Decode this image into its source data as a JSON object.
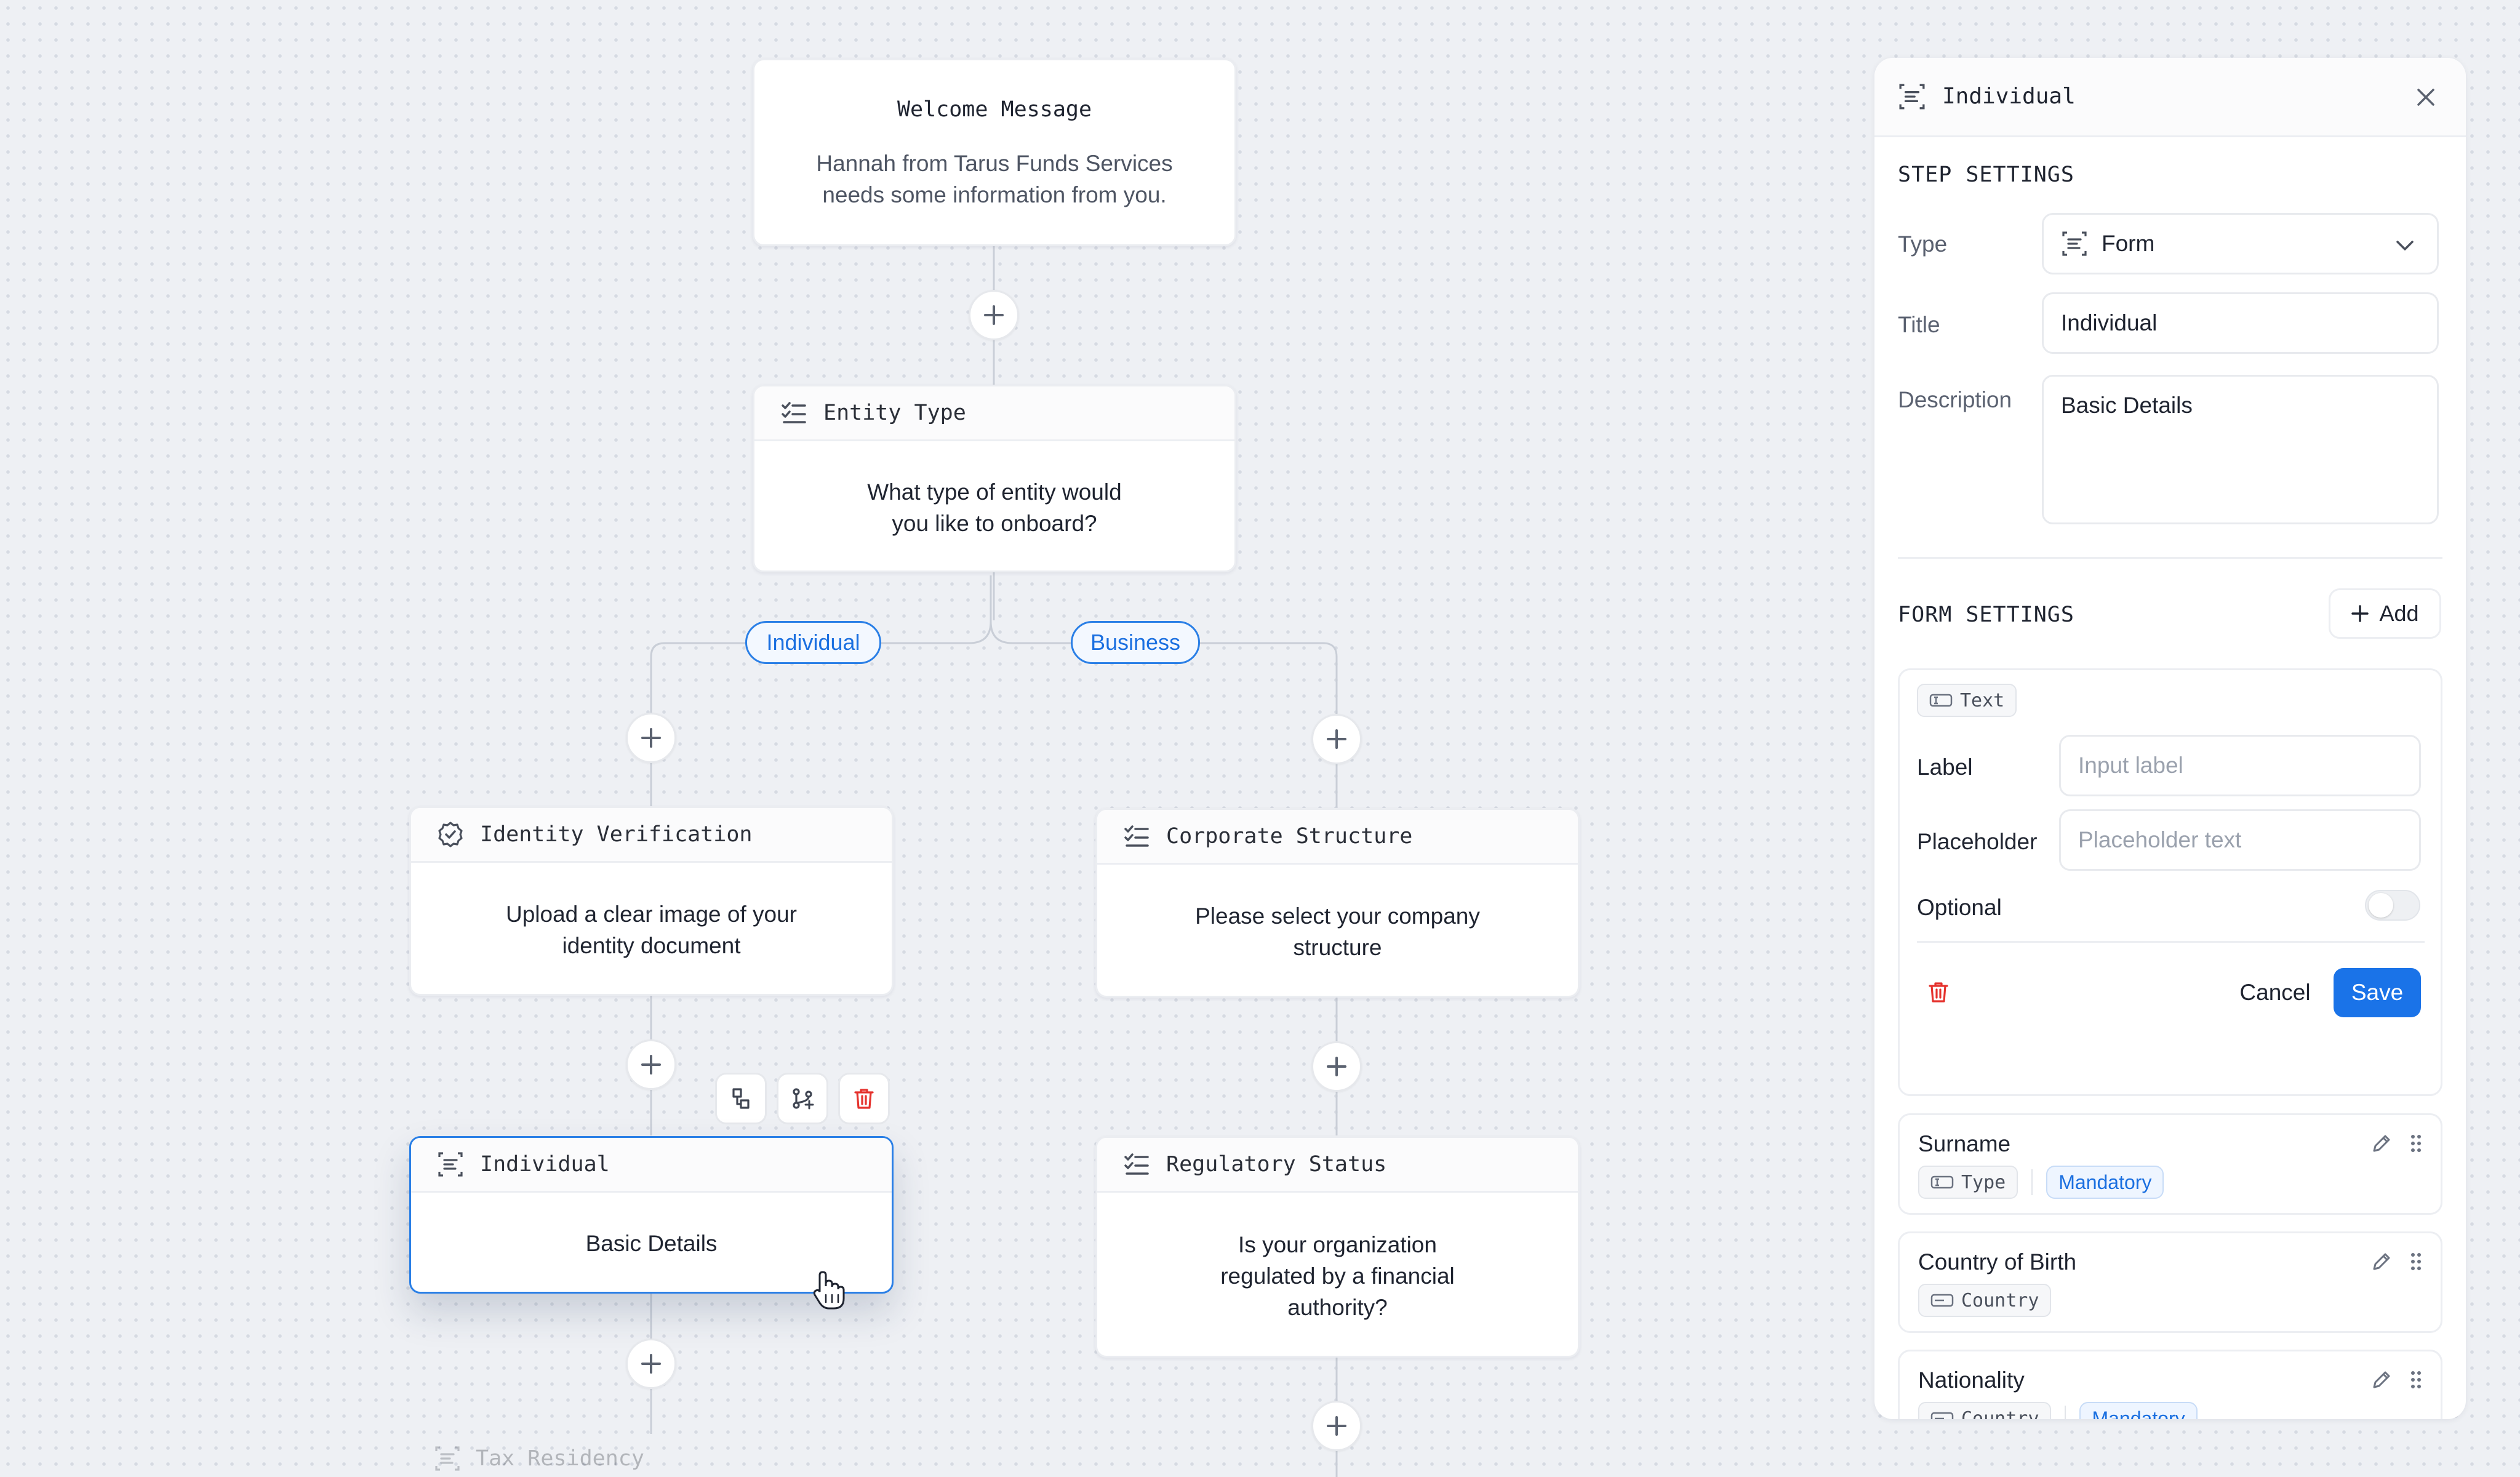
{
  "canvas": {
    "welcome": {
      "title": "Welcome Message",
      "body_line1": "Hannah from Tarus Funds Services",
      "body_line2": "needs some information from you."
    },
    "entity_type": {
      "title": "Entity Type",
      "body_line1": "What type of entity would",
      "body_line2": "you like to onboard?"
    },
    "branch_individual": "Individual",
    "branch_business": "Business",
    "identity": {
      "title": "Identity Verification",
      "body_line1": "Upload a clear image of your",
      "body_line2": "identity document"
    },
    "corporate": {
      "title": "Corporate Structure",
      "body_line1": "Please select your company",
      "body_line2": "structure"
    },
    "individual": {
      "title": "Individual",
      "body": "Basic Details"
    },
    "regulatory": {
      "title": "Regulatory Status",
      "body_line1": "Is your organization",
      "body_line2": "regulated by a financial",
      "body_line3": "authority?"
    },
    "tax": {
      "title": "Tax Residency"
    },
    "node_toolbar_icons": [
      "duplicate-icon",
      "branch-icon",
      "trash-icon"
    ]
  },
  "panel": {
    "title": "Individual",
    "step_settings": {
      "heading": "STEP SETTINGS",
      "type_label": "Type",
      "type_value": "Form",
      "title_label": "Title",
      "title_value": "Individual",
      "description_label": "Description",
      "description_value": "Basic Details"
    },
    "form_settings": {
      "heading": "FORM SETTINGS",
      "add_label": "Add",
      "editor": {
        "type_chip": "Text",
        "label_label": "Label",
        "label_placeholder": "Input label",
        "placeholder_label": "Placeholder",
        "placeholder_placeholder": "Placeholder text",
        "optional_label": "Optional",
        "optional_on": false,
        "cancel_label": "Cancel",
        "save_label": "Save"
      },
      "fields": [
        {
          "title": "Surname",
          "chip": "Type",
          "badge": "Mandatory"
        },
        {
          "title": "Country of Birth",
          "chip": "Country"
        },
        {
          "title": "Nationality",
          "chip": "Country",
          "badge": "Mandatory"
        }
      ]
    }
  },
  "colors": {
    "accent": "#2a7fe6",
    "danger": "#e5322d",
    "canvas_bg": "#eef0f4"
  }
}
